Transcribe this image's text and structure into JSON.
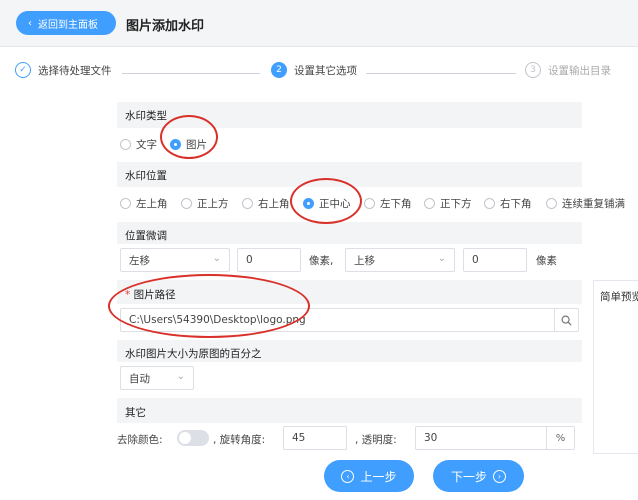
{
  "header": {
    "back_label": "返回到主面板",
    "title": "图片添加水印"
  },
  "steps": [
    {
      "num": "✓",
      "label": "选择待处理文件"
    },
    {
      "num": "2",
      "label": "设置其它选项"
    },
    {
      "num": "3",
      "label": "设置输出目录"
    }
  ],
  "watermark_type": {
    "title": "水印类型",
    "options": [
      "文字",
      "图片"
    ],
    "selected": "图片"
  },
  "watermark_position": {
    "title": "水印位置",
    "options": [
      "左上角",
      "正上方",
      "右上角",
      "正中心",
      "左下角",
      "正下方",
      "右下角",
      "连续重复铺满"
    ],
    "selected": "正中心"
  },
  "fine_tune": {
    "title": "位置微调",
    "h_dir": "左移",
    "h_value": "0",
    "h_unit": "像素,",
    "v_dir": "上移",
    "v_value": "0",
    "v_unit": "像素"
  },
  "image_path": {
    "required_mark": "*",
    "title": "图片路径",
    "value": "C:\\Users\\54390\\Desktop\\logo.png"
  },
  "scale": {
    "title": "水印图片大小为原图的百分之",
    "value": "自动"
  },
  "other": {
    "title": "其它",
    "remove_color_label": "去除颜色:",
    "rotate_label": ", 旋转角度:",
    "rotate_value": "45",
    "opacity_label": ", 透明度:",
    "opacity_value": "30",
    "percent": "%"
  },
  "preview": {
    "title": "简单预览"
  },
  "footer": {
    "prev_label": "上一步",
    "next_label": "下一步"
  },
  "colors": {
    "accent": "#409eff",
    "annotation": "#d9312a"
  }
}
